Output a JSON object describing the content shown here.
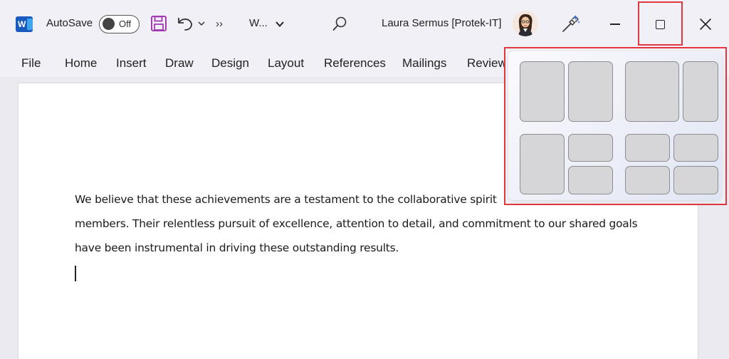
{
  "titlebar": {
    "app_icon_letter": "W",
    "autosave_label": "AutoSave",
    "autosave_state": "Off",
    "doc_title": "W...",
    "user_name": "Laura Sermus [Protek-IT]",
    "more_glyph": "››"
  },
  "ribbon": {
    "tabs": [
      "File",
      "Home",
      "Insert",
      "Draw",
      "Design",
      "Layout",
      "References",
      "Mailings",
      "Review"
    ]
  },
  "document": {
    "lines": [
      "We believe that these achievements are a testament to the collaborative spirit",
      "members. Their relentless pursuit of excellence, attention to detail, and commitment to our shared goals",
      "have been instrumental in driving these outstanding results."
    ]
  },
  "snap_layouts": {
    "layouts": [
      "two-halves",
      "wide-left-narrow-right",
      "left-half-right-stacked",
      "four-quadrants"
    ]
  },
  "colors": {
    "highlight": "#e0383e",
    "word_blue": "#185abd",
    "save_purple": "#a33ab4"
  },
  "icons": [
    "word-app-icon",
    "save-icon",
    "undo-icon",
    "chevron-down-icon",
    "search-icon",
    "designer-wand-icon",
    "minimize-icon",
    "maximize-icon",
    "close-icon"
  ]
}
